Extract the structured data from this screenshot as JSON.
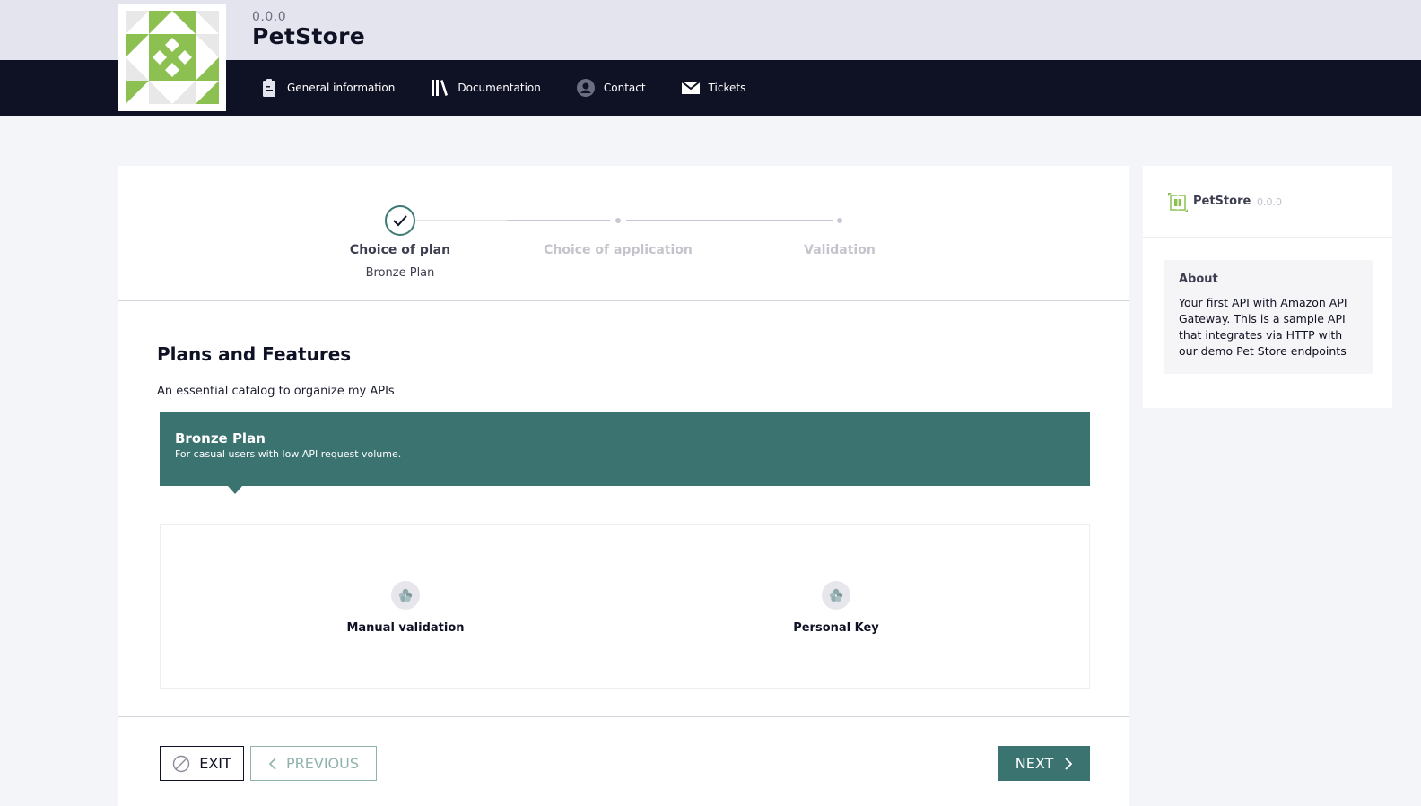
{
  "app": {
    "version": "0.0.0",
    "name": "PetStore"
  },
  "nav": {
    "items": [
      {
        "label": "General information",
        "icon": "clipboard-icon"
      },
      {
        "label": "Documentation",
        "icon": "books-icon"
      },
      {
        "label": "Contact",
        "icon": "user-icon"
      },
      {
        "label": "Tickets",
        "icon": "envelope-icon"
      }
    ]
  },
  "stepper": {
    "steps": [
      {
        "title": "Choice of plan",
        "subtitle": "Bronze Plan",
        "state": "done"
      },
      {
        "title": "Choice of application",
        "subtitle": "",
        "state": "pending"
      },
      {
        "title": "Validation",
        "subtitle": "",
        "state": "pending"
      }
    ]
  },
  "main": {
    "section_title": "Plans and Features",
    "section_desc": "An essential catalog to organize my APIs",
    "plan": {
      "name": "Bronze Plan",
      "description": "For casual users with low API request volume."
    },
    "features": [
      {
        "label": "Manual validation"
      },
      {
        "label": "Personal Key"
      }
    ]
  },
  "actions": {
    "exit": "EXIT",
    "previous": "PREVIOUS",
    "next": "NEXT"
  },
  "side": {
    "name": "PetStore",
    "version": "0.0.0",
    "about_title": "About",
    "about_text": "Your first API with Amazon API Gateway. This is a sample API that integrates via HTTP with our demo Pet Store endpoints"
  },
  "colors": {
    "accent": "#3b7370",
    "navbar": "#0f1124",
    "topbar": "#e4e4ee",
    "logo_green": "#8cc152"
  }
}
